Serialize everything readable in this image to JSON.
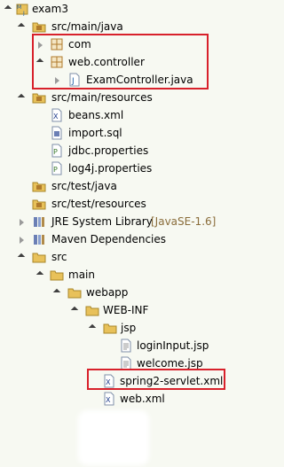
{
  "tree": {
    "project": "exam3",
    "src_main_java": "src/main/java",
    "pkg_com": "com",
    "pkg_web_controller": "web.controller",
    "exam_controller": "ExamController.java",
    "src_main_resources": "src/main/resources",
    "beans_xml": "beans.xml",
    "import_sql": "import.sql",
    "jdbc_properties": "jdbc.properties",
    "log4j_properties": "log4j.properties",
    "src_test_java": "src/test/java",
    "src_test_resources": "src/test/resources",
    "jre_library": "JRE System Library",
    "jre_version": "[JavaSE-1.6]",
    "maven_dependencies": "Maven Dependencies",
    "src": "src",
    "main": "main",
    "webapp": "webapp",
    "web_inf": "WEB-INF",
    "jsp": "jsp",
    "login_input_jsp": "loginInput.jsp",
    "welcome_jsp": "welcome.jsp",
    "spring2_servlet_xml": "spring2-servlet.xml",
    "web_xml": "web.xml"
  },
  "colors": {
    "highlight": "#d8212b",
    "folder": "#e8c15a",
    "package": "#b07a2c",
    "library": "#6b7fb5"
  }
}
